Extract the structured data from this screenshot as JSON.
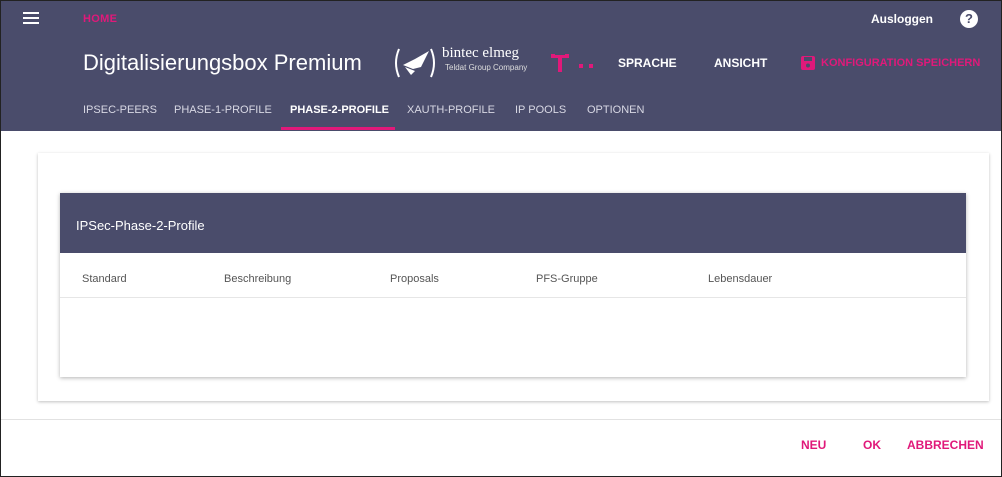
{
  "topbar": {
    "home_label": "HOME",
    "logout_label": "Ausloggen",
    "help_glyph": "?"
  },
  "header": {
    "product_title": "Digitalisierungsbox Premium",
    "brand_name": "bintec elmeg",
    "brand_subtitle": "Teldat Group Company",
    "language_label": "SPRACHE",
    "view_label": "ANSICHT",
    "save_config_label": "KONFIGURATION SPEICHERN"
  },
  "tabs": [
    {
      "label": "IPSEC-PEERS",
      "active": false
    },
    {
      "label": "PHASE-1-PROFILE",
      "active": false
    },
    {
      "label": "PHASE-2-PROFILE",
      "active": true
    },
    {
      "label": "XAUTH-PROFILE",
      "active": false
    },
    {
      "label": "IP POOLS",
      "active": false
    },
    {
      "label": "OPTIONEN",
      "active": false
    }
  ],
  "panel": {
    "title": "IPSec-Phase-2-Profile",
    "columns": [
      "Standard",
      "Beschreibung",
      "Proposals",
      "PFS-Gruppe",
      "Lebensdauer"
    ],
    "rows": []
  },
  "footer": {
    "new_label": "NEU",
    "ok_label": "OK",
    "cancel_label": "ABBRECHEN"
  },
  "colors": {
    "header_bg": "#4a4c6b",
    "accent": "#e0197a"
  },
  "icons": {
    "menu": "hamburger-icon",
    "help": "help-icon",
    "save": "floppy-disk-icon",
    "brand": "bird-logo-icon",
    "telekom": "telekom-t-logo"
  }
}
